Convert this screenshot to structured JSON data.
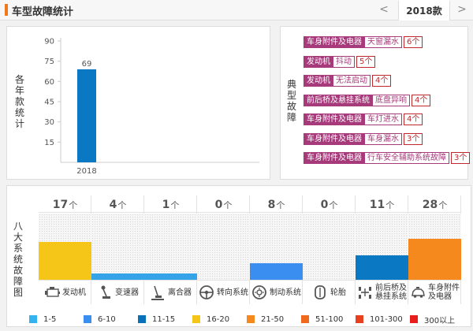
{
  "header": {
    "title": "车型故障统计",
    "prev_glyph": "<",
    "next_glyph": ">",
    "active_tab": "2018款",
    "accent": "#f07a1b"
  },
  "year_panel": {
    "vertical_label": "各年款统计",
    "chart_data": {
      "type": "bar",
      "categories": [
        "2018"
      ],
      "values": [
        69
      ],
      "data_labels": [
        "69"
      ],
      "ylim": [
        0,
        90
      ],
      "yticks": [
        15,
        30,
        45,
        60,
        75,
        90
      ],
      "color": "#0a78c2",
      "grid": false
    }
  },
  "typical_panel": {
    "vertical_label": "典型故障",
    "items": [
      {
        "category": "车身附件及电器",
        "problem": "天窗漏水",
        "count": "6个"
      },
      {
        "category": "发动机",
        "problem": "抖动",
        "count": "5个"
      },
      {
        "category": "发动机",
        "problem": "无法启动",
        "count": "4个"
      },
      {
        "category": "前后桥及悬挂系统",
        "problem": "底盘异响",
        "count": "4个"
      },
      {
        "category": "车身附件及电器",
        "problem": "车灯进水",
        "count": "4个"
      },
      {
        "category": "车身附件及电器",
        "problem": "车身漏水",
        "count": "3个"
      },
      {
        "category": "车身附件及电器",
        "problem": "行车安全辅助系统故障",
        "count": "3个"
      }
    ]
  },
  "systems_panel": {
    "vertical_label": "八大系统故障图",
    "unit": "个",
    "systems": [
      {
        "name": "发动机",
        "count": "17",
        "level": 0.57,
        "color": "#f5c518",
        "icon": "engine-icon"
      },
      {
        "name": "变速器",
        "count": "4",
        "level": 0.1,
        "color": "#35a3e8",
        "icon": "gear-shift-icon"
      },
      {
        "name": "离合器",
        "count": "1",
        "level": 0.1,
        "color": "#35a3e8",
        "icon": "clutch-pedal-icon"
      },
      {
        "name": "转向系统",
        "count": "0",
        "level": 0,
        "color": "#35a3e8",
        "icon": "steering-wheel-icon"
      },
      {
        "name": "制动系统",
        "count": "8",
        "level": 0.25,
        "color": "#3a8ef0",
        "icon": "brake-disc-icon"
      },
      {
        "name": "轮胎",
        "count": "0",
        "level": 0,
        "color": "#35a3e8",
        "icon": "tire-icon"
      },
      {
        "name": "前后桥及悬挂系统",
        "name_line1": "前后桥及",
        "name_line2": "悬挂系统",
        "count": "11",
        "level": 0.37,
        "color": "#0a78c2",
        "icon": "suspension-icon"
      },
      {
        "name": "车身附件及电器",
        "name_line1": "车身附件",
        "name_line2": "及电器",
        "count": "28",
        "level": 0.62,
        "color": "#f5891e",
        "icon": "car-body-icon"
      }
    ],
    "legend": [
      {
        "label": "1-5",
        "color": "#35b3f0"
      },
      {
        "label": "6-10",
        "color": "#3a8ef0"
      },
      {
        "label": "11-15",
        "color": "#0a70b8"
      },
      {
        "label": "16-20",
        "color": "#f5c518"
      },
      {
        "label": "21-50",
        "color": "#f5891e"
      },
      {
        "label": "51-100",
        "color": "#f06a1e"
      },
      {
        "label": "101-300",
        "color": "#e8401e"
      },
      {
        "label": "300以上",
        "color": "#e81e1e"
      }
    ]
  }
}
